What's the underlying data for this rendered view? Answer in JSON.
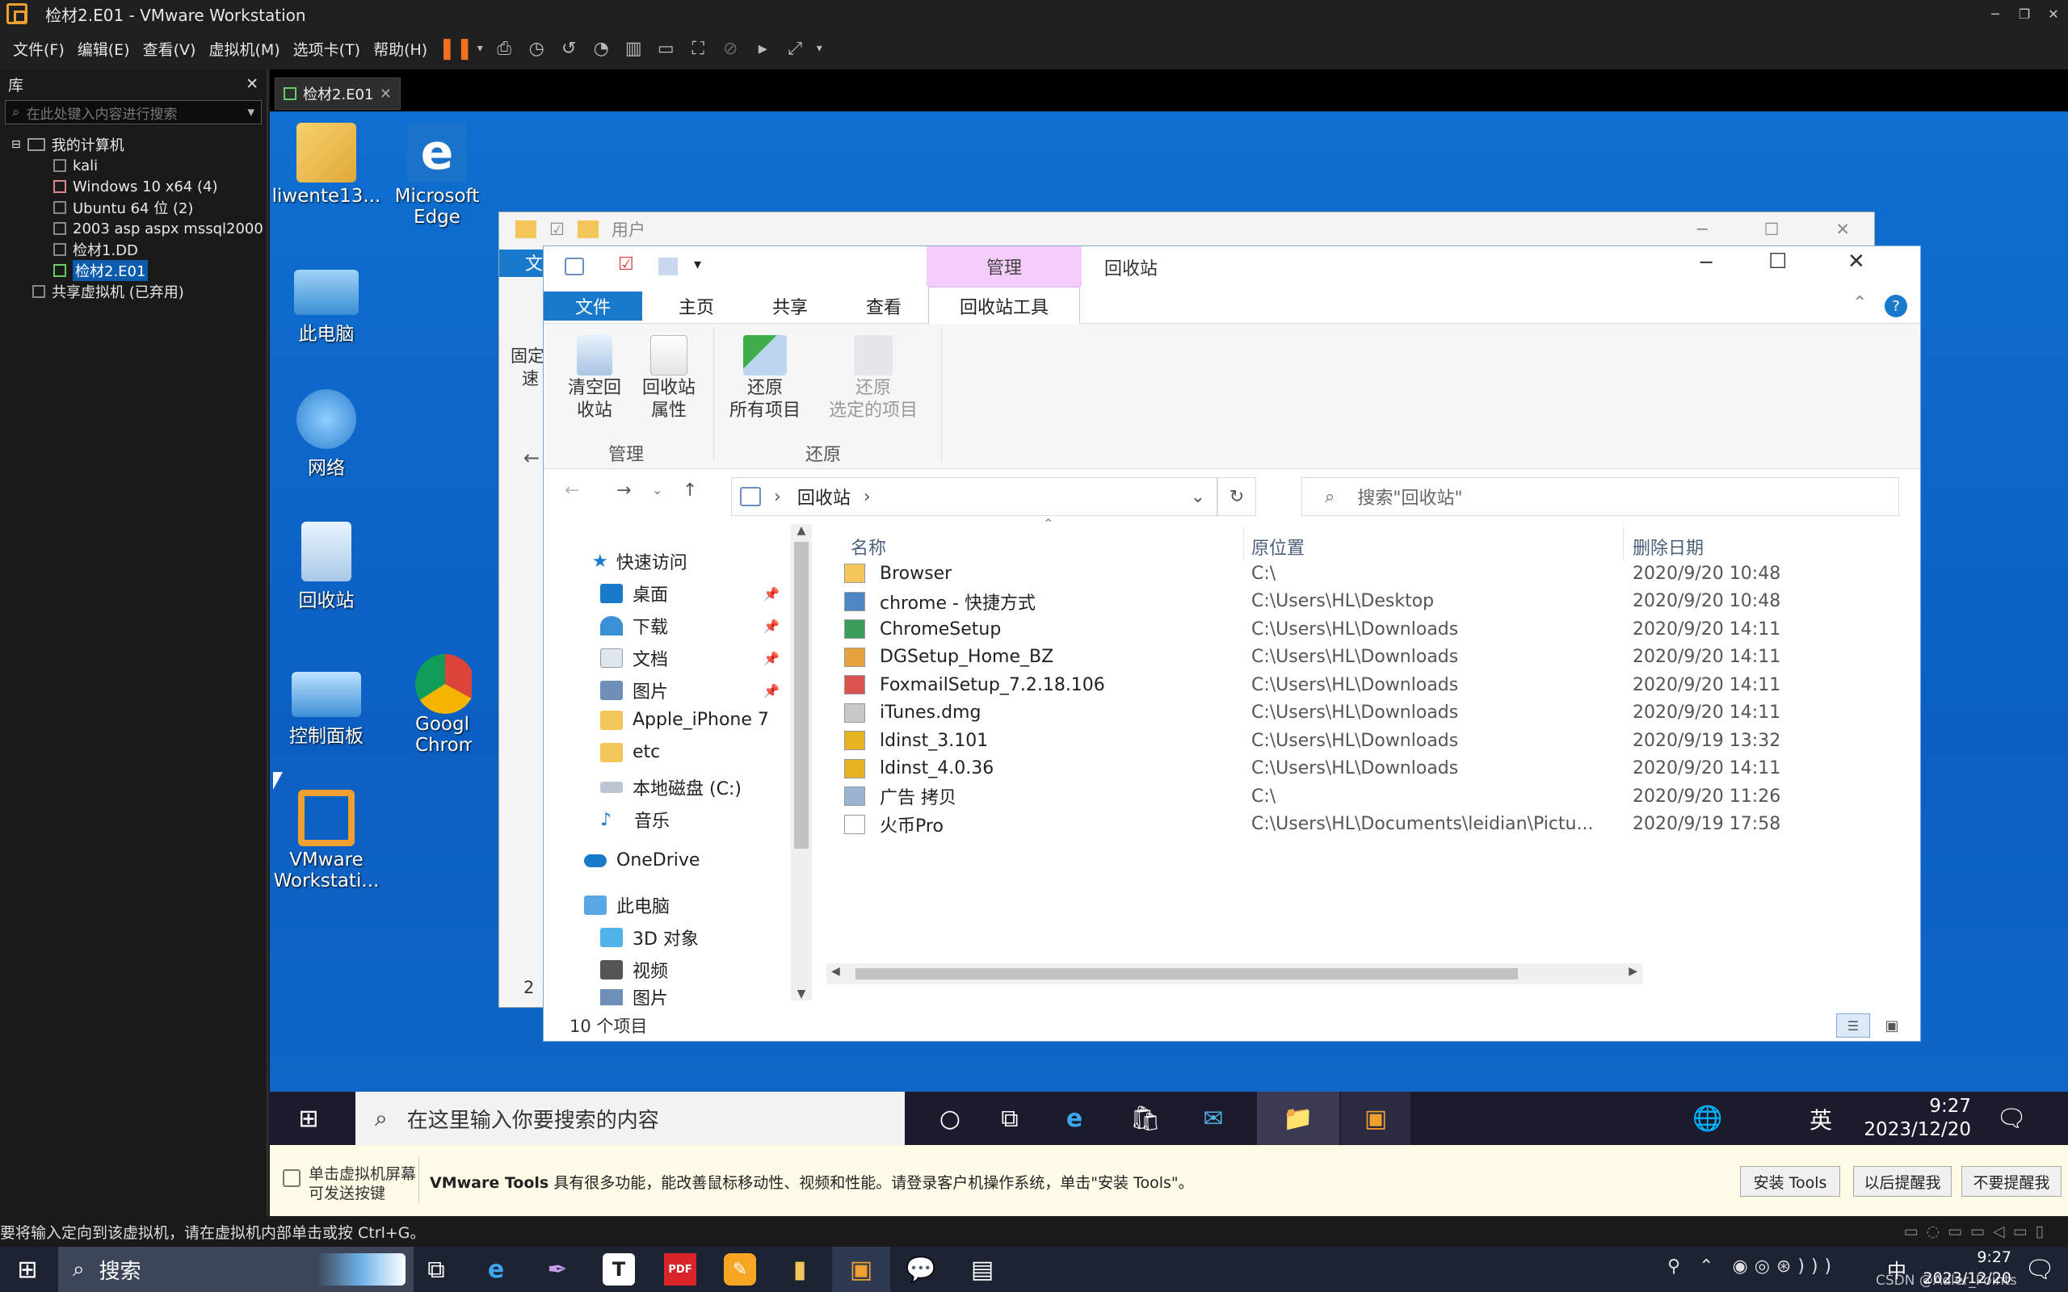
{
  "window": {
    "title": "检材2.E01 - VMware Workstation"
  },
  "menu": [
    "文件(F)",
    "编辑(E)",
    "查看(V)",
    "虚拟机(M)",
    "选项卡(T)",
    "帮助(H)"
  ],
  "library": {
    "title": "库",
    "search_placeholder": "在此处键入内容进行搜索",
    "root": "我的计算机",
    "items": [
      "kali",
      "Windows 10 x64 (4)",
      "Ubuntu 64 位 (2)",
      "2003 asp aspx mssql2000",
      "检材1.DD",
      "检材2.E01"
    ],
    "shared": "共享虚拟机 (已弃用)"
  },
  "vm_tab": {
    "label": "检材2.E01"
  },
  "desktop_icons": [
    {
      "label": "liwente13..."
    },
    {
      "label": "Microsoft Edge"
    },
    {
      "label": "此电脑"
    },
    {
      "label": "网络"
    },
    {
      "label": "回收站"
    },
    {
      "label": "控制面板"
    },
    {
      "label": "Googl Chrom"
    },
    {
      "label": "VMware Workstati..."
    }
  ],
  "back_window": {
    "title": "用户",
    "fragments": [
      "文",
      "固定",
      "速",
      "2"
    ]
  },
  "explorer": {
    "context_tab": "管理",
    "title": "回收站",
    "tabs": [
      "文件",
      "主页",
      "共享",
      "查看",
      "回收站工具"
    ],
    "ribbon": {
      "buttons": [
        {
          "label1": "清空回",
          "label2": "收站"
        },
        {
          "label1": "回收站",
          "label2": "属性"
        },
        {
          "label1": "还原",
          "label2": "所有项目"
        },
        {
          "label1": "还原",
          "label2": "选定的项目"
        }
      ],
      "groups": [
        "管理",
        "还原"
      ]
    },
    "address": {
      "path": "回收站",
      "search_placeholder": "搜索\"回收站\""
    },
    "nav": {
      "quick_access": "快速访问",
      "items": [
        "桌面",
        "下载",
        "文档",
        "图片",
        "Apple_iPhone 7",
        "etc",
        "本地磁盘 (C:)",
        "音乐"
      ],
      "onedrive": "OneDrive",
      "this_pc": "此电脑",
      "pc_items": [
        "3D 对象",
        "视频",
        "图片"
      ]
    },
    "columns": [
      "名称",
      "原位置",
      "删除日期"
    ],
    "files": [
      {
        "name": "Browser",
        "loc": "C:\\",
        "date": "2020/9/20 10:48"
      },
      {
        "name": "chrome - 快捷方式",
        "loc": "C:\\Users\\HL\\Desktop",
        "date": "2020/9/20 10:48"
      },
      {
        "name": "ChromeSetup",
        "loc": "C:\\Users\\HL\\Downloads",
        "date": "2020/9/20 14:11"
      },
      {
        "name": "DGSetup_Home_BZ",
        "loc": "C:\\Users\\HL\\Downloads",
        "date": "2020/9/20 14:11"
      },
      {
        "name": "FoxmailSetup_7.2.18.106",
        "loc": "C:\\Users\\HL\\Downloads",
        "date": "2020/9/20 14:11"
      },
      {
        "name": "iTunes.dmg",
        "loc": "C:\\Users\\HL\\Downloads",
        "date": "2020/9/20 14:11"
      },
      {
        "name": "ldinst_3.101",
        "loc": "C:\\Users\\HL\\Downloads",
        "date": "2020/9/19 13:32"
      },
      {
        "name": "ldinst_4.0.36",
        "loc": "C:\\Users\\HL\\Downloads",
        "date": "2020/9/20 14:11"
      },
      {
        "name": "广告 拷贝",
        "loc": "C:\\",
        "date": "2020/9/20 11:26"
      },
      {
        "name": "火币Pro",
        "loc": "C:\\Users\\HL\\Documents\\leidian\\Pictu...",
        "date": "2020/9/19 17:58"
      }
    ],
    "status": "10 个项目"
  },
  "guest_taskbar": {
    "search_placeholder": "在这里输入你要搜索的内容",
    "ime": "英",
    "time": "9:27",
    "date": "2023/12/20"
  },
  "notice": {
    "hint1": "单击虚拟机屏幕",
    "hint2": "可发送按键",
    "message_bold": "VMware Tools",
    "message": "具有很多功能，能改善鼠标移动性、视频和性能。请登录客户机操作系统，单击\"安装 Tools\"。",
    "buttons": [
      "安装 Tools",
      "以后提醒我",
      "不要提醒我"
    ]
  },
  "status_line": "要将输入定向到该虚拟机，请在虚拟机内部单击或按 Ctrl+G。",
  "host_taskbar": {
    "search": "搜索",
    "ime": "中",
    "time": "9:27",
    "date": "2023/12/20",
    "watermark": "CSDN @Adler_Points"
  }
}
